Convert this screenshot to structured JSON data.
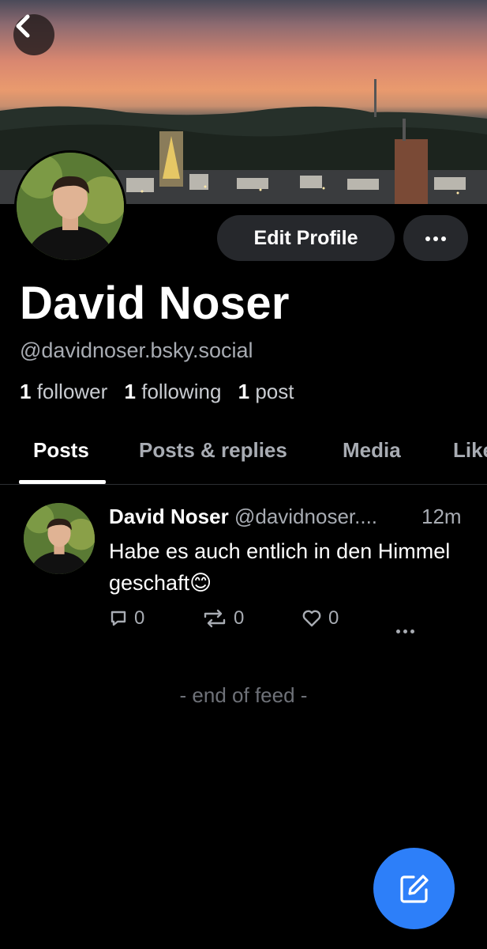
{
  "profile": {
    "display_name": "David Noser",
    "handle": "@davidnoser.bsky.social",
    "edit_label": "Edit Profile",
    "stats": {
      "followers_count": "1",
      "followers_label": "follower",
      "following_count": "1",
      "following_label": "following",
      "posts_count": "1",
      "posts_label": "post"
    }
  },
  "tabs": [
    {
      "label": "Posts"
    },
    {
      "label": "Posts & replies"
    },
    {
      "label": "Media"
    },
    {
      "label": "Likes"
    }
  ],
  "post": {
    "author": "David Noser",
    "handle": "@davidnoser....",
    "time": "12m",
    "text": "Habe es auch entlich in den Himmel geschaft😊",
    "reply_count": "0",
    "repost_count": "0",
    "like_count": "0"
  },
  "feed": {
    "end_label": "- end of feed -"
  },
  "colors": {
    "accent": "#2d7ff9",
    "background": "#000000",
    "button_bg": "#26282c",
    "muted_text": "#a8acb3"
  },
  "icons": [
    "back-arrow-icon",
    "more-icon",
    "reply-icon",
    "repost-icon",
    "like-icon",
    "compose-icon"
  ]
}
